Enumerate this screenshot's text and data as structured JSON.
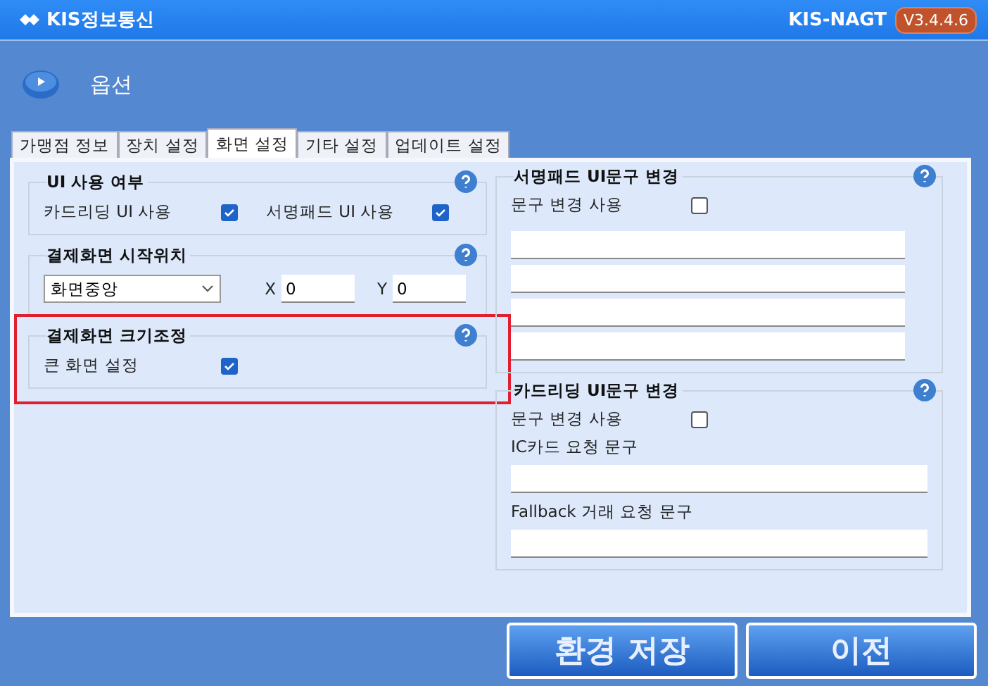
{
  "header": {
    "brand": "KIS정보통신",
    "product": "KIS-NAGT",
    "version": "V3.4.4.6"
  },
  "page_title": "옵션",
  "tabs": [
    {
      "label": "가맹점 정보",
      "selected": false
    },
    {
      "label": "장치 설정",
      "selected": false
    },
    {
      "label": "화면 설정",
      "selected": true
    },
    {
      "label": "기타 설정",
      "selected": false
    },
    {
      "label": "업데이트 설정",
      "selected": false
    }
  ],
  "left_groups": [
    {
      "title": "UI 사용 여부",
      "highlighted": false,
      "kind": "checks",
      "items": [
        {
          "label": "카드리딩 UI 사용",
          "checked": true
        },
        {
          "label": "서명패드 UI 사용",
          "checked": true
        }
      ]
    },
    {
      "title": "결제화면 시작위치",
      "highlighted": false,
      "kind": "position",
      "select": {
        "value": "화면중앙"
      },
      "fields": [
        {
          "label": "X",
          "value": "0"
        },
        {
          "label": "Y",
          "value": "0"
        }
      ]
    },
    {
      "title": "결제화면 크기조정",
      "highlighted": true,
      "kind": "checks",
      "items": [
        {
          "label": "큰 화면 설정",
          "checked": true
        }
      ]
    }
  ],
  "right_groups": [
    {
      "title": "서명패드 UI문구 변경",
      "toggle": {
        "label": "문구 변경 사용",
        "checked": false
      },
      "fields": [
        {
          "kind": "blank"
        },
        {
          "kind": "blank"
        },
        {
          "kind": "blank"
        },
        {
          "kind": "blank"
        }
      ]
    },
    {
      "title": "카드리딩 UI문구 변경",
      "toggle": {
        "label": "문구 변경 사용",
        "checked": false
      },
      "fields": [
        {
          "kind": "labeled",
          "label": "IC카드 요청 문구"
        },
        {
          "kind": "labeled",
          "label": "Fallback 거래 요청 문구"
        }
      ]
    }
  ],
  "buttons": [
    {
      "label": "환경 저장"
    },
    {
      "label": "이전"
    }
  ]
}
